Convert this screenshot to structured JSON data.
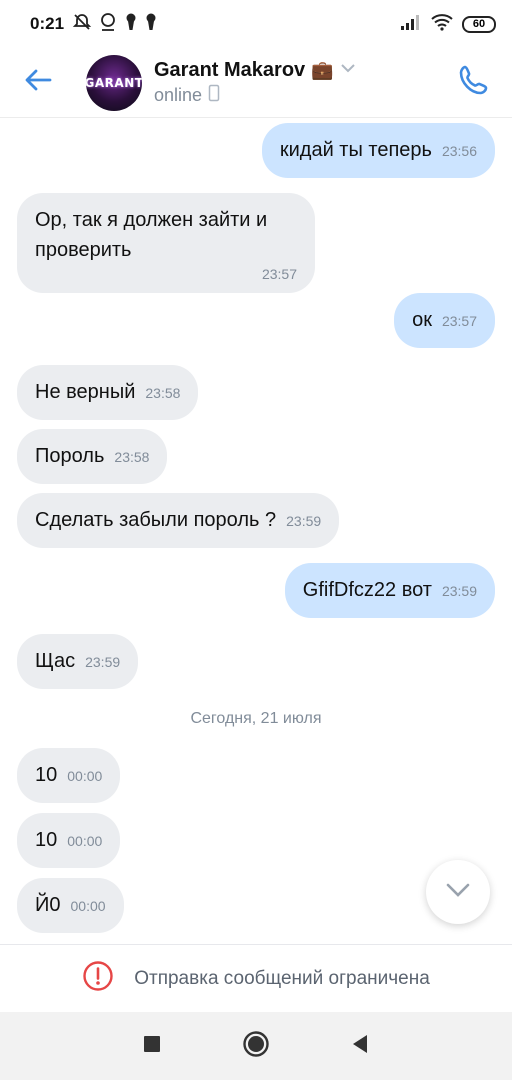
{
  "status_bar": {
    "time": "0:21",
    "battery": "60",
    "icons": [
      "mute-icon",
      "alarm-icon",
      "keyhole-icon",
      "keyhole-icon",
      "signal-icon",
      "wifi-icon"
    ]
  },
  "header": {
    "name": "Garant Makarov",
    "name_emoji": "💼",
    "status": "online",
    "avatar_text": "GARANT",
    "accent": "#3f8ae0"
  },
  "messages": [
    {
      "dir": "out",
      "text": "кидай ты теперь",
      "time": "23:56"
    },
    {
      "dir": "in",
      "text": "Ор, так я должен зайти и проверить",
      "time": "23:57"
    },
    {
      "dir": "out",
      "text": "ок",
      "time": "23:57"
    },
    {
      "dir": "in",
      "text": "Не верный",
      "time": "23:58"
    },
    {
      "dir": "in",
      "text": "Пороль",
      "time": "23:58"
    },
    {
      "dir": "in",
      "text": "Сделать забыли пороль ?",
      "time": "23:59"
    },
    {
      "dir": "out",
      "text": "GfifDfcz22 вот",
      "time": "23:59"
    },
    {
      "dir": "in",
      "text": "Щас",
      "time": "23:59"
    },
    {
      "dir": "in",
      "text": "10",
      "time": "00:00"
    },
    {
      "dir": "in",
      "text": "10",
      "time": "00:00"
    },
    {
      "dir": "in",
      "text": "Й0",
      "time": "00:00"
    }
  ],
  "date_separator": "Сегодня, 21 июля",
  "restriction": {
    "text": "Отправка сообщений ограничена",
    "color": "#e64646"
  }
}
